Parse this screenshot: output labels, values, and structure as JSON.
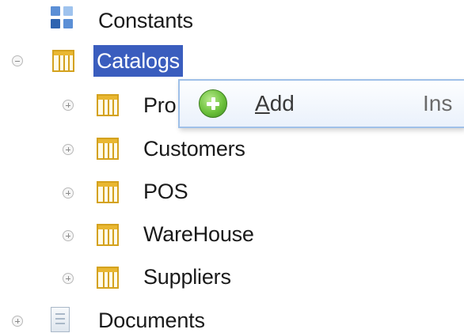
{
  "tree": {
    "constants": {
      "label": "Constants",
      "icon": "constants-icon"
    },
    "catalogs": {
      "label": "Catalogs",
      "state": "expanded",
      "selected": true,
      "children": [
        {
          "label": "Products",
          "visible_text": "Pro"
        },
        {
          "label": "Customers"
        },
        {
          "label": "POS"
        },
        {
          "label": "WareHouse"
        },
        {
          "label": "Suppliers"
        }
      ]
    },
    "documents": {
      "label": "Documents",
      "icon": "documents-icon",
      "state": "collapsed"
    }
  },
  "context_menu": {
    "items": [
      {
        "label_prefix": "",
        "accelerator": "A",
        "label_rest": "dd",
        "shortcut": "Ins",
        "icon": "add-icon"
      }
    ]
  },
  "colors": {
    "selection": "#3a5dbe",
    "menu_border": "#9fc0e8",
    "catalog_icon": "#e9b731",
    "add_icon": "#6cc13b"
  }
}
